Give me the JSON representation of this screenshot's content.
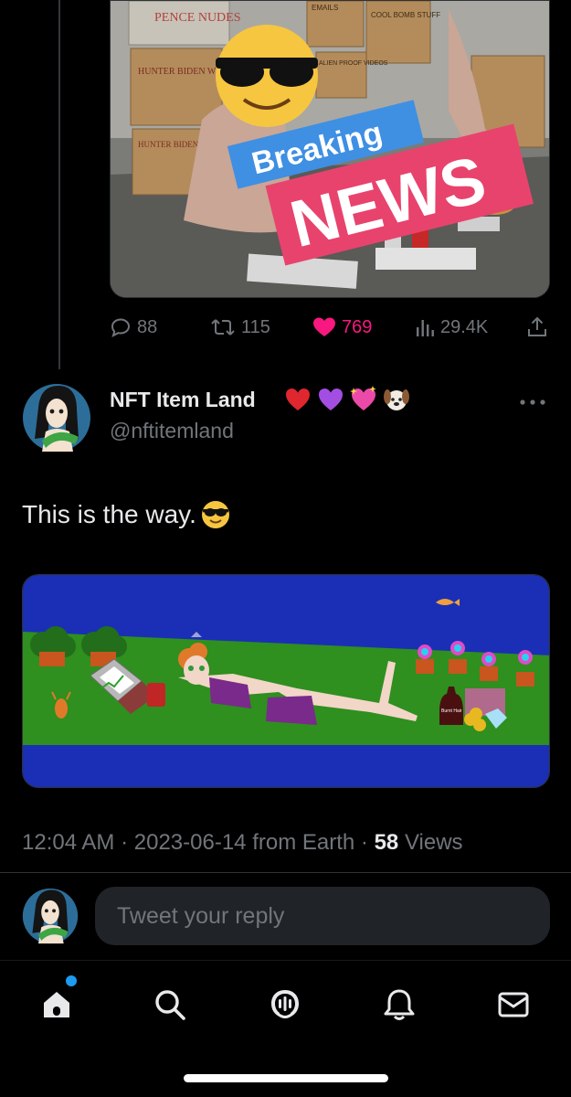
{
  "previous_tweet": {
    "media": {
      "box_labels": [
        "PENCE NUDES",
        "EMAILS",
        "COOL BOMB STUFF",
        "HUNTER BIDEN WEINER PICS (3)",
        "ALIEN PROOF VIDEOS",
        "HUNTER BIDEN WEINER PICS (2)"
      ],
      "banner_top": "Breaking",
      "banner_bottom": "NEWS"
    },
    "actions": {
      "replies": "88",
      "retweets": "115",
      "likes": "769",
      "views": "29.4K"
    }
  },
  "tweet": {
    "author_name": "NFT Item Land",
    "author_emojis": [
      "heart-red-emoji",
      "heart-purple-emoji",
      "sparkling-heart-emoji",
      "dog-face-emoji"
    ],
    "handle": "@nftitemland",
    "text": "This is the way.",
    "text_emoji": "smiling-face-with-sunglasses-emoji",
    "media": {
      "label": "Burnt Hair"
    },
    "time": "12:04 AM",
    "date": "2023-06-14",
    "source": "from Earth",
    "views_count": "58",
    "views_label": "Views",
    "sep": "·"
  },
  "reply": {
    "placeholder": "Tweet your reply"
  },
  "tab_bar": {
    "tabs": [
      "home-icon",
      "search-icon",
      "spaces-icon",
      "notifications-icon",
      "messages-icon"
    ]
  },
  "colors": {
    "background": "#000000",
    "text_primary": "#e7e9ea",
    "text_secondary": "#71767b",
    "like_pink": "#f91880",
    "accent_blue": "#1d9bf0"
  }
}
